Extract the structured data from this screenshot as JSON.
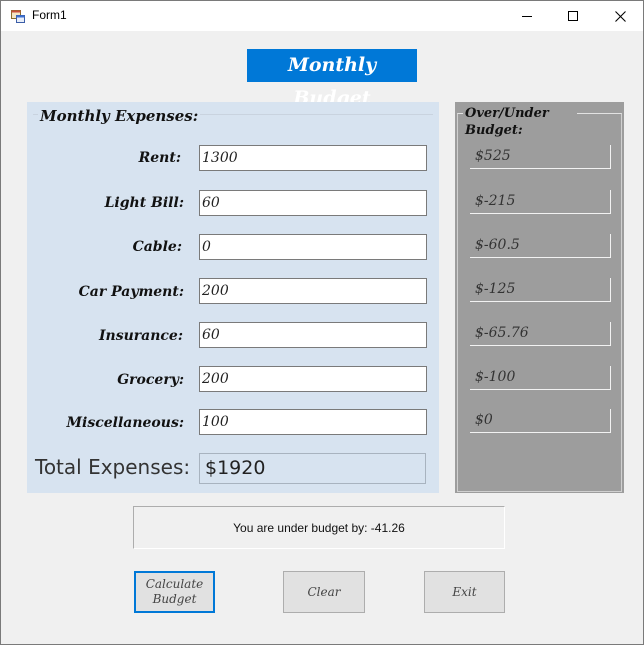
{
  "window": {
    "title": "Form1"
  },
  "heading": "Monthly Budget",
  "expenses": {
    "title": "Monthly Expenses:",
    "rows": [
      {
        "label": "Rent:",
        "value": "1300"
      },
      {
        "label": "Light Bill:",
        "value": "60"
      },
      {
        "label": "Cable:",
        "value": "0"
      },
      {
        "label": "Car Payment:",
        "value": "200"
      },
      {
        "label": "Insurance:",
        "value": "60"
      },
      {
        "label": "Grocery:",
        "value": "200"
      },
      {
        "label": "Miscellaneous:",
        "value": "100"
      }
    ],
    "total_label": "Total Expenses:",
    "total_value": "$1920"
  },
  "over_under": {
    "title": "Over/Under Budget:",
    "values": [
      "$525",
      "$-215",
      "$-60.5",
      "$-125",
      "$-65.76",
      "$-100",
      "$0"
    ]
  },
  "status": "You are under budget by: -41.26",
  "buttons": {
    "calculate": "Calculate Budget",
    "clear": "Clear",
    "exit": "Exit"
  },
  "colors": {
    "accent": "#0078d7",
    "expenses_bg": "#d7e3f0",
    "over_under_bg": "#9d9d9d"
  }
}
